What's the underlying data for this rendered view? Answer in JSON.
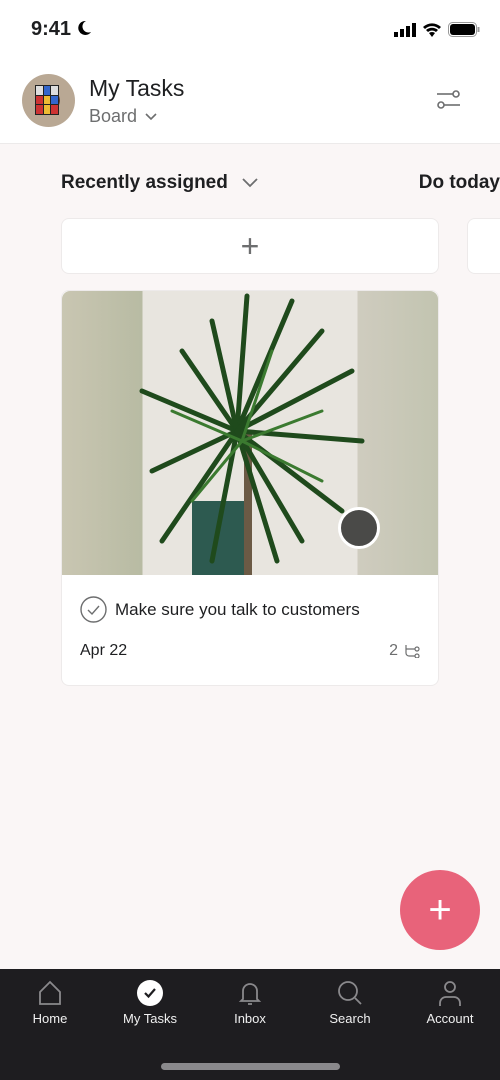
{
  "status_bar": {
    "time": "9:41"
  },
  "header": {
    "title": "My Tasks",
    "view": "Board"
  },
  "columns": [
    {
      "title": "Recently assigned",
      "tasks": [
        {
          "name": "Make sure you talk to customers",
          "due": "Apr 22",
          "subtasks": "2"
        }
      ]
    },
    {
      "title": "Do today"
    }
  ],
  "colors": {
    "accent": "#e8637a",
    "tabbar": "#1e1d20"
  },
  "tabbar": {
    "items": [
      {
        "label": "Home",
        "icon": "home-icon"
      },
      {
        "label": "My Tasks",
        "icon": "check-circle-icon",
        "active": true
      },
      {
        "label": "Inbox",
        "icon": "bell-icon"
      },
      {
        "label": "Search",
        "icon": "search-icon"
      },
      {
        "label": "Account",
        "icon": "person-icon"
      }
    ]
  }
}
